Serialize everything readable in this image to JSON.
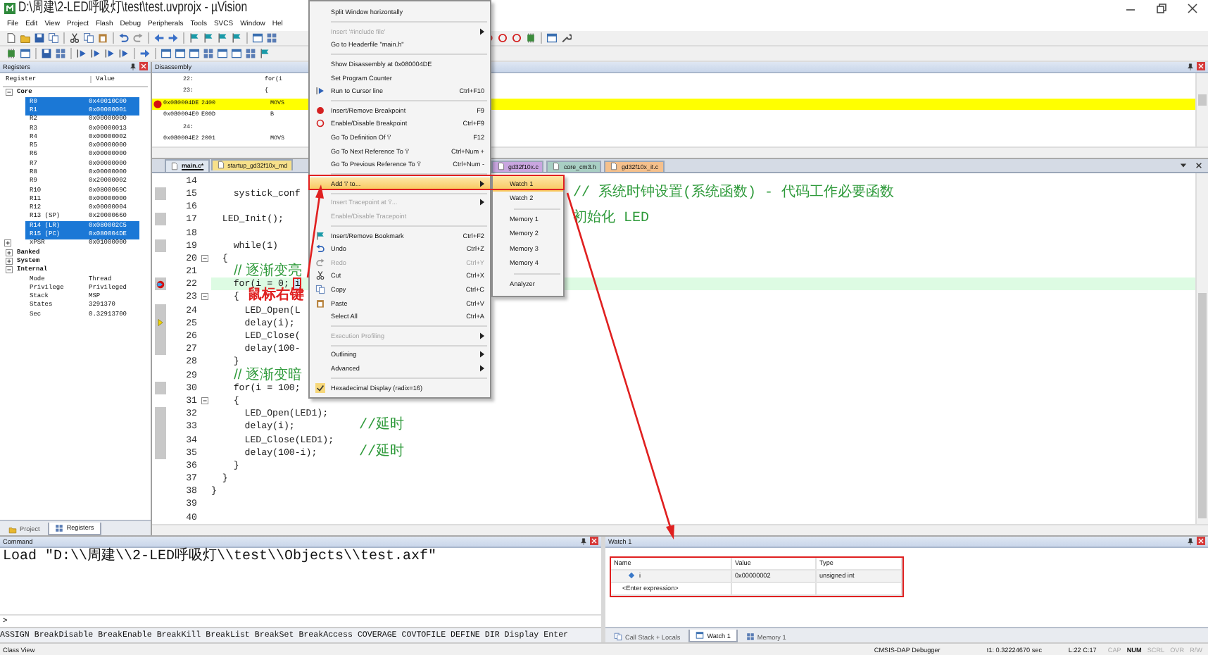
{
  "window": {
    "title": "D:\\周建\\2-LED呼吸灯\\test\\test.uvprojx - µVision"
  },
  "menu_bar": [
    "File",
    "Edit",
    "View",
    "Project",
    "Flash",
    "Debug",
    "Peripherals",
    "Tools",
    "SVCS",
    "Window",
    "Hel"
  ],
  "registers_panel": {
    "title": "Registers",
    "columns": [
      "Register",
      "Value"
    ],
    "groups": [
      {
        "name": "Core",
        "expanded": true,
        "children": [
          {
            "name": "R0",
            "value": "0x40010C00",
            "selected": true
          },
          {
            "name": "R1",
            "value": "0x00000001",
            "selected": true
          },
          {
            "name": "R2",
            "value": "0x00000000",
            "selected": false
          },
          {
            "name": "R3",
            "value": "0x00000013",
            "selected": false
          },
          {
            "name": "R4",
            "value": "0x00000002",
            "selected": false
          },
          {
            "name": "R5",
            "value": "0x00000000",
            "selected": false
          },
          {
            "name": "R6",
            "value": "0x00000000",
            "selected": false
          },
          {
            "name": "R7",
            "value": "0x00000000",
            "selected": false
          },
          {
            "name": "R8",
            "value": "0x00000000",
            "selected": false
          },
          {
            "name": "R9",
            "value": "0x20000002",
            "selected": false
          },
          {
            "name": "R10",
            "value": "0x0800069C",
            "selected": false
          },
          {
            "name": "R11",
            "value": "0x00000000",
            "selected": false
          },
          {
            "name": "R12",
            "value": "0x00000004",
            "selected": false
          },
          {
            "name": "R13 (SP)",
            "value": "0x20000660",
            "selected": false
          },
          {
            "name": "R14 (LR)",
            "value": "0x080002C5",
            "selected": true
          },
          {
            "name": "R15 (PC)",
            "value": "0x080004DE",
            "selected": true
          },
          {
            "name": "xPSR",
            "value": "0x01000000",
            "selected": false,
            "expanded": false
          }
        ]
      },
      {
        "name": "Banked",
        "expanded": false
      },
      {
        "name": "System",
        "expanded": false
      },
      {
        "name": "Internal",
        "expanded": true,
        "children": [
          {
            "name": "Mode",
            "value": "Thread",
            "selected": false
          },
          {
            "name": "Privilege",
            "value": "Privileged",
            "selected": false
          },
          {
            "name": "Stack",
            "value": "MSP",
            "selected": false
          },
          {
            "name": "States",
            "value": "3291370",
            "selected": false
          },
          {
            "name": "Sec",
            "value": "0.32913700",
            "selected": false
          }
        ]
      }
    ],
    "tabs": [
      {
        "label": "Project",
        "selected": false
      },
      {
        "label": "Registers",
        "selected": true
      }
    ]
  },
  "disassembly": {
    "title": "Disassembly",
    "rows": [
      {
        "kind": "source",
        "line": "22:",
        "text": "for(i",
        "highlighted": false,
        "breakpoint": false
      },
      {
        "kind": "source",
        "line": "23:",
        "text": "{",
        "highlighted": false,
        "breakpoint": false
      },
      {
        "kind": "instruction",
        "address": "0x080004DE",
        "opcode": "2400",
        "mnemonic": "MOVS",
        "highlighted": true,
        "breakpoint": true
      },
      {
        "kind": "instruction",
        "address": "0x080004E0",
        "opcode": "E00D",
        "mnemonic": "B",
        "highlighted": false,
        "breakpoint": false
      },
      {
        "kind": "source",
        "line": "24:",
        "highlighted": false,
        "breakpoint": false
      },
      {
        "kind": "instruction",
        "address": "0x080004E2",
        "opcode": "2001",
        "mnemonic": "MOVS",
        "highlighted": false,
        "breakpoint": false
      }
    ]
  },
  "editor": {
    "tabs": [
      {
        "label": "main.c*",
        "selected": true,
        "color": "#dfe6f0"
      },
      {
        "label": "startup_gd32f10x_md",
        "selected": false,
        "color": "#f7e08a"
      },
      {
        "label": "gd32f10x.c",
        "selected": false,
        "color": "#c9a6e0"
      },
      {
        "label": "core_cm3.h",
        "selected": false,
        "color": "#a9cfc4"
      },
      {
        "label": "gd32f10x_it.c",
        "selected": false,
        "color": "#f5c08c"
      }
    ],
    "lines": [
      {
        "num": "14",
        "highlighted": false,
        "executable": false,
        "fold": false
      },
      {
        "num": "15",
        "code": "    systick_conf",
        "comment": {
          "kind": "far",
          "text": "// 系统时钟设置(系统函数) - 代码工作必要函数"
        },
        "highlighted": false,
        "executable": true,
        "fold": false
      },
      {
        "num": "16",
        "highlighted": false,
        "executable": false,
        "fold": false
      },
      {
        "num": "17",
        "code": "  LED_Init();",
        "comment": {
          "kind": "far",
          "text": "初始化 LED"
        },
        "highlighted": false,
        "executable": true,
        "fold": false
      },
      {
        "num": "18",
        "highlighted": false,
        "executable": false,
        "fold": false
      },
      {
        "num": "19",
        "code": "    while(1)",
        "highlighted": false,
        "executable": true,
        "fold": false
      },
      {
        "num": "20",
        "code": "  {",
        "highlighted": false,
        "executable": false,
        "fold": true
      },
      {
        "num": "21",
        "code": "    // 逐渐变亮",
        "kind": "comment",
        "highlighted": false,
        "executable": false,
        "fold": false
      },
      {
        "num": "22",
        "code": "    for(i = 0; ",
        "target": "i",
        "kind": "breakpoint",
        "highlighted": true,
        "executable": true,
        "fold": false
      },
      {
        "num": "23",
        "code": "    {",
        "highlighted": false,
        "executable": false,
        "fold": true
      },
      {
        "num": "24",
        "code": "      LED_Open(L",
        "highlighted": false,
        "executable": true,
        "fold": false
      },
      {
        "num": "25",
        "code": "      delay(i);",
        "kind": "pc",
        "highlighted": false,
        "executable": true,
        "fold": false
      },
      {
        "num": "26",
        "code": "      LED_Close(",
        "highlighted": false,
        "executable": true,
        "fold": false
      },
      {
        "num": "27",
        "code": "      delay(100-",
        "highlighted": false,
        "executable": true,
        "fold": false
      },
      {
        "num": "28",
        "code": "    }",
        "highlighted": false,
        "executable": false,
        "fold": false
      },
      {
        "num": "29",
        "code": "    // 逐渐变暗",
        "kind": "comment",
        "highlighted": false,
        "executable": false,
        "fold": false
      },
      {
        "num": "30",
        "code": "    for(i = 100;",
        "highlighted": false,
        "executable": true,
        "fold": false
      },
      {
        "num": "31",
        "code": "    {",
        "highlighted": false,
        "executable": false,
        "fold": true
      },
      {
        "num": "32",
        "code": "      LED_Open(LED1);",
        "highlighted": false,
        "executable": true,
        "fold": false
      },
      {
        "num": "33",
        "code": "      delay(i);",
        "comment": {
          "kind": "near",
          "text": "//延时"
        },
        "highlighted": false,
        "executable": true,
        "fold": false
      },
      {
        "num": "34",
        "code": "      LED_Close(LED1);",
        "highlighted": false,
        "executable": true,
        "fold": false
      },
      {
        "num": "35",
        "code": "      delay(100-i);",
        "comment": {
          "kind": "near",
          "text": "//延时"
        },
        "highlighted": false,
        "executable": true,
        "fold": false
      },
      {
        "num": "36",
        "code": "    }",
        "highlighted": false,
        "executable": false,
        "fold": false
      },
      {
        "num": "37",
        "code": "  }",
        "highlighted": false,
        "executable": false,
        "fold": false
      },
      {
        "num": "38",
        "code": "}",
        "highlighted": false,
        "executable": false,
        "fold": false
      },
      {
        "num": "39",
        "highlighted": false,
        "executable": false,
        "fold": false
      },
      {
        "num": "40",
        "highlighted": false,
        "executable": false,
        "fold": false
      }
    ],
    "annotation": "鼠标右键"
  },
  "context_menu": {
    "items": [
      {
        "kind": "item",
        "label": "Split Window horizontally",
        "disabled": false,
        "submenu": false,
        "selected": false
      },
      {
        "kind": "separator"
      },
      {
        "kind": "item",
        "label": "Insert '#include file'",
        "disabled": true,
        "submenu": true,
        "selected": false
      },
      {
        "kind": "item",
        "label": "Go to Headerfile \"main.h\"",
        "disabled": false,
        "submenu": false,
        "selected": false
      },
      {
        "kind": "separator"
      },
      {
        "kind": "item",
        "label": "Show Disassembly at 0x080004DE",
        "disabled": false,
        "submenu": false,
        "selected": false
      },
      {
        "kind": "item",
        "label": "Set Program Counter",
        "disabled": false,
        "submenu": false,
        "selected": false
      },
      {
        "kind": "item",
        "label": "Run to Cursor line",
        "shortcut": "Ctrl+F10",
        "disabled": false,
        "submenu": false,
        "selected": false
      },
      {
        "kind": "separator"
      },
      {
        "kind": "item",
        "label": "Insert/Remove Breakpoint",
        "shortcut": "F9",
        "disabled": false,
        "submenu": false,
        "selected": false
      },
      {
        "kind": "item",
        "label": "Enable/Disable Breakpoint",
        "shortcut": "Ctrl+F9",
        "disabled": false,
        "submenu": false,
        "selected": false
      },
      {
        "kind": "item",
        "label": "Go To Definition Of 'i'",
        "shortcut": "F12",
        "disabled": false,
        "submenu": false,
        "selected": false
      },
      {
        "kind": "item",
        "label": "Go To Next Reference To 'i'",
        "shortcut": "Ctrl+Num +",
        "disabled": false,
        "submenu": false,
        "selected": false
      },
      {
        "kind": "item",
        "label": "Go To Previous Reference To 'i'",
        "shortcut": "Ctrl+Num -",
        "disabled": false,
        "submenu": false,
        "selected": false
      },
      {
        "kind": "separator"
      },
      {
        "kind": "item",
        "label": "Add 'i' to...",
        "disabled": false,
        "submenu": true,
        "selected": true
      },
      {
        "kind": "separator"
      },
      {
        "kind": "item",
        "label": "Insert Tracepoint at 'i'...",
        "disabled": true,
        "submenu": true,
        "selected": false
      },
      {
        "kind": "item",
        "label": "Enable/Disable Tracepoint",
        "disabled": true,
        "submenu": false,
        "selected": false
      },
      {
        "kind": "separator"
      },
      {
        "kind": "item",
        "label": "Insert/Remove Bookmark",
        "shortcut": "Ctrl+F2",
        "disabled": false,
        "submenu": false,
        "selected": false
      },
      {
        "kind": "item",
        "label": "Undo",
        "shortcut": "Ctrl+Z",
        "disabled": false,
        "submenu": false,
        "selected": false
      },
      {
        "kind": "item",
        "label": "Redo",
        "shortcut": "Ctrl+Y",
        "disabled": true,
        "submenu": false,
        "selected": false
      },
      {
        "kind": "item",
        "label": "Cut",
        "shortcut": "Ctrl+X",
        "disabled": false,
        "submenu": false,
        "selected": false
      },
      {
        "kind": "item",
        "label": "Copy",
        "shortcut": "Ctrl+C",
        "disabled": false,
        "submenu": false,
        "selected": false
      },
      {
        "kind": "item",
        "label": "Paste",
        "shortcut": "Ctrl+V",
        "disabled": false,
        "submenu": false,
        "selected": false
      },
      {
        "kind": "item",
        "label": "Select All",
        "shortcut": "Ctrl+A",
        "disabled": false,
        "submenu": false,
        "selected": false
      },
      {
        "kind": "separator"
      },
      {
        "kind": "item",
        "label": "Execution Profiling",
        "disabled": true,
        "submenu": true,
        "selected": false
      },
      {
        "kind": "separator"
      },
      {
        "kind": "item",
        "label": "Outlining",
        "disabled": false,
        "submenu": true,
        "selected": false
      },
      {
        "kind": "item",
        "label": "Advanced",
        "disabled": false,
        "submenu": true,
        "selected": false
      },
      {
        "kind": "separator"
      },
      {
        "kind": "item",
        "label": "Hexadecimal Display (radix=16)",
        "disabled": false,
        "submenu": false,
        "selected": false,
        "checked": true
      }
    ]
  },
  "submenu": {
    "items": [
      {
        "kind": "item",
        "label": "Watch 1",
        "selected": true
      },
      {
        "kind": "item",
        "label": "Watch 2",
        "selected": false
      },
      {
        "kind": "separator"
      },
      {
        "kind": "item",
        "label": "Memory 1",
        "selected": false
      },
      {
        "kind": "item",
        "label": "Memory 2",
        "selected": false
      },
      {
        "kind": "item",
        "label": "Memory 3",
        "selected": false
      },
      {
        "kind": "item",
        "label": "Memory 4",
        "selected": false
      },
      {
        "kind": "separator"
      },
      {
        "kind": "item",
        "label": "Analyzer",
        "selected": false
      }
    ]
  },
  "command": {
    "title": "Command",
    "output": "Load \"D:\\\\周建\\\\2-LED呼吸灯\\\\test\\\\Objects\\\\test.axf\"",
    "prompt": ">",
    "hints": "ASSIGN BreakDisable BreakEnable BreakKill BreakList BreakSet BreakAccess COVERAGE COVTOFILE DEFINE DIR Display Enter"
  },
  "watch": {
    "title": "Watch 1",
    "columns": [
      "Name",
      "Value",
      "Type"
    ],
    "rows": [
      {
        "kind": "variable",
        "name": "i",
        "value": "0x00000002",
        "type": "unsigned int"
      },
      {
        "kind": "entry",
        "name": "<Enter expression>"
      }
    ],
    "tabs": [
      {
        "label": "Call Stack + Locals",
        "selected": false
      },
      {
        "label": "Watch 1",
        "selected": true
      },
      {
        "label": "Memory 1",
        "selected": false
      }
    ]
  },
  "status_bar": {
    "left": "Class View",
    "debugger": "CMSIS-DAP Debugger",
    "time": "t1: 0.32224670 sec",
    "position": "L:22 C:17",
    "indicators": [
      {
        "label": "CAP",
        "on": false
      },
      {
        "label": "NUM",
        "on": true
      },
      {
        "label": "SCRL",
        "on": false
      },
      {
        "label": "OVR",
        "on": false
      },
      {
        "label": "R/W",
        "on": false
      }
    ]
  }
}
